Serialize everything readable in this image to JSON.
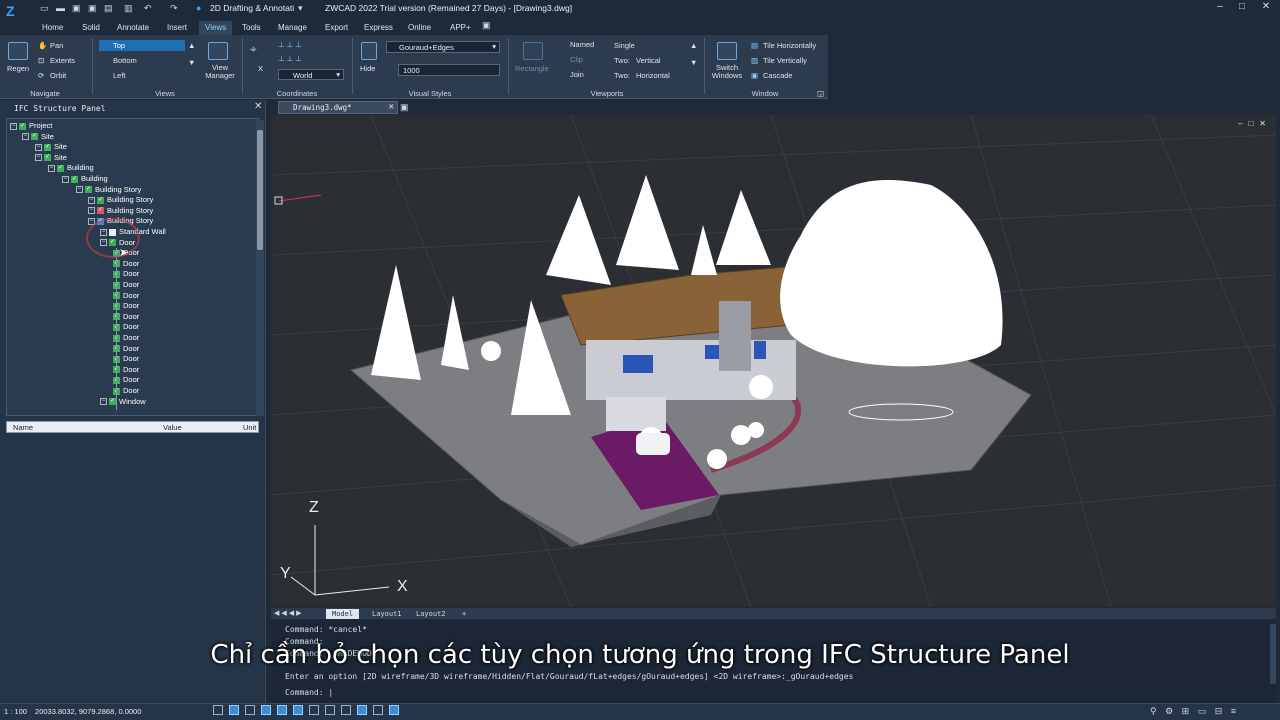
{
  "app": {
    "workspace": "2D Drafting & Annotati",
    "window_title": "ZWCAD 2022 Trial version (Remained 27 Days) - [Drawing3.dwg]"
  },
  "menu_tabs": [
    "Home",
    "Solid",
    "Annotate",
    "Insert",
    "Views",
    "Tools",
    "Manage",
    "Export",
    "Express",
    "Online",
    "APP+"
  ],
  "active_tab": "Views",
  "ribbon": {
    "navigate": {
      "title": "Navigate",
      "regen": "Regen",
      "pan": "Pan",
      "extents": "Extents",
      "orbit": "Orbit"
    },
    "views": {
      "title": "Views",
      "items": [
        "Top",
        "Bottom",
        "Left"
      ],
      "view_manager": "View Manager"
    },
    "coordinates": {
      "title": "Coordinates",
      "world": "World",
      "x_label": "X"
    },
    "visual_styles": {
      "title": "Visual Styles",
      "style": "Gouraud+Edges",
      "hide": "Hide",
      "value": "1000"
    },
    "viewports": {
      "title": "Viewports",
      "rectangle": "Rectangle",
      "named": "Named",
      "clip": "Clip",
      "join": "Join",
      "single": "Single",
      "two_vertical_a": "Two:",
      "two_vertical_b": "Vertical",
      "two_horizontal_a": "Two:",
      "two_horizontal_b": "Horizontal"
    },
    "window": {
      "title": "Window",
      "switch": "Switch Windows",
      "tile_h": "Tile Horizontally",
      "tile_v": "Tile Vertically",
      "cascade": "Cascade"
    }
  },
  "panel": {
    "title": "IFC Structure Panel",
    "tree": [
      {
        "label": "Project",
        "level": 0,
        "chk": "green"
      },
      {
        "label": "Site",
        "level": 1,
        "chk": "green"
      },
      {
        "label": "Site",
        "level": 2,
        "chk": "green"
      },
      {
        "label": "Site",
        "level": 2,
        "chk": "green"
      },
      {
        "label": "Building",
        "level": 3,
        "chk": "green"
      },
      {
        "label": "Building",
        "level": 4,
        "chk": "green"
      },
      {
        "label": "Building Story",
        "level": 5,
        "chk": "green"
      },
      {
        "label": "Building Story",
        "level": 6,
        "chk": "green"
      },
      {
        "label": "Building Story",
        "level": 6,
        "chk": "red"
      },
      {
        "label": "Building Story",
        "level": 6,
        "chk": "blue"
      },
      {
        "label": "Standard Wall",
        "level": 7,
        "chk": "off"
      },
      {
        "label": "Door",
        "level": 7,
        "chk": "green"
      },
      {
        "label": "Door",
        "level": 8,
        "chk": "green"
      },
      {
        "label": "Door",
        "level": 8,
        "chk": "green"
      },
      {
        "label": "Door",
        "level": 8,
        "chk": "green"
      },
      {
        "label": "Door",
        "level": 8,
        "chk": "green"
      },
      {
        "label": "Door",
        "level": 8,
        "chk": "green"
      },
      {
        "label": "Door",
        "level": 8,
        "chk": "green"
      },
      {
        "label": "Door",
        "level": 8,
        "chk": "green"
      },
      {
        "label": "Door",
        "level": 8,
        "chk": "green"
      },
      {
        "label": "Door",
        "level": 8,
        "chk": "green"
      },
      {
        "label": "Door",
        "level": 8,
        "chk": "green"
      },
      {
        "label": "Door",
        "level": 8,
        "chk": "green"
      },
      {
        "label": "Door",
        "level": 8,
        "chk": "green"
      },
      {
        "label": "Door",
        "level": 8,
        "chk": "green"
      },
      {
        "label": "Door",
        "level": 8,
        "chk": "green"
      },
      {
        "label": "Window",
        "level": 7,
        "chk": "green"
      }
    ],
    "props_headers": {
      "name": "Name",
      "value": "Value",
      "unit": "Unit"
    }
  },
  "document": {
    "tab": "Drawing3.dwg*"
  },
  "axis": {
    "x": "X",
    "y": "Y",
    "z": "Z"
  },
  "layout_tabs": [
    "Model",
    "Layout1",
    "Layout2",
    "+"
  ],
  "command": {
    "lines": [
      "Command: *cancel*",
      "Command:",
      "Command: _SHADEMODE",
      "Enter an option [2D wireframe/3D wireframe/Hidden/Flat/Gouraud/fLat+edges/gOuraud+edges] <2D wireframe>:_gOuraud+edges",
      "Command: |"
    ]
  },
  "subtitle": "Chỉ cần bỏ chọn các tùy chọn tương ứng trong IFC Structure Panel",
  "status": {
    "coords": "20033.8032, 9079.2868, 0.0000",
    "scale_left": "1 : 100"
  }
}
